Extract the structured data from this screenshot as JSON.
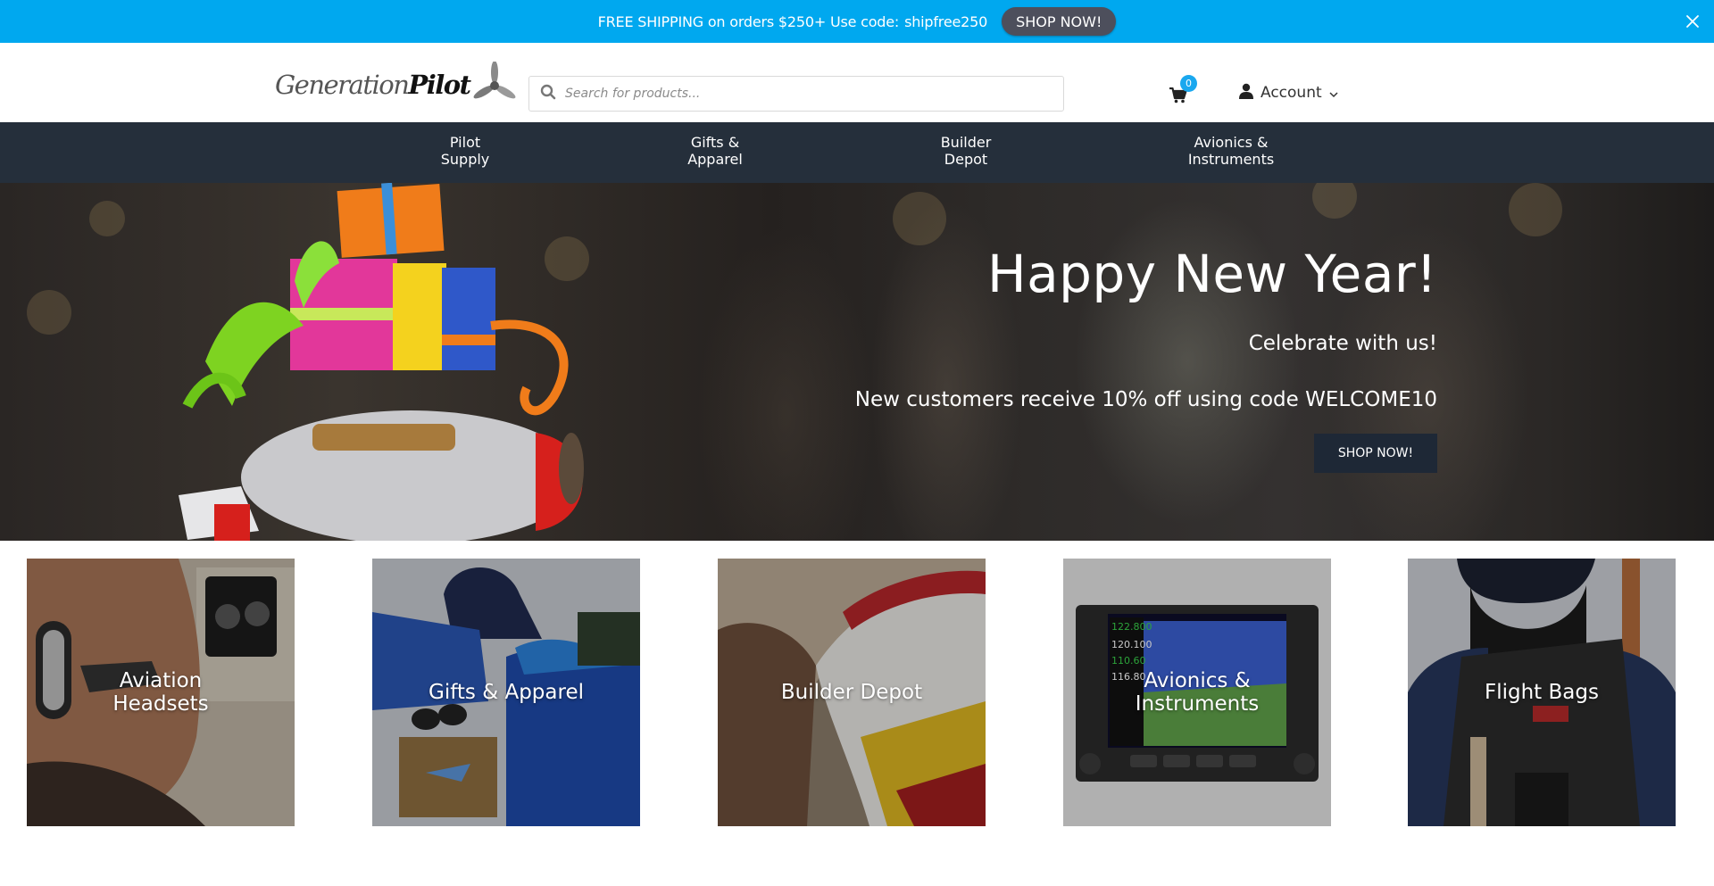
{
  "promo": {
    "text": "FREE SHIPPING on orders $250+ Use code:",
    "code": "shipfree250",
    "button_label": "SHOP NOW!",
    "background_color": "#00a8ef"
  },
  "header": {
    "logo_text_light": "Generation",
    "logo_text_strong": "Pilot",
    "search_placeholder": "Search for products...",
    "cart_count": "0",
    "account_label": "Account"
  },
  "nav": {
    "items": [
      {
        "line1": "Pilot",
        "line2": "Supply"
      },
      {
        "line1": "Gifts &",
        "line2": "Apparel"
      },
      {
        "line1": "Builder",
        "line2": "Depot"
      },
      {
        "line1": "Avionics &",
        "line2": "Instruments"
      }
    ]
  },
  "hero": {
    "title": "Happy New Year!",
    "subtitle": "Celebrate with us!",
    "offer": "New customers receive 10% off using code WELCOME10",
    "button_label": "SHOP NOW!"
  },
  "categories": [
    {
      "line1": "Aviation",
      "line2": "Headsets"
    },
    {
      "line1": "Gifts & Apparel",
      "line2": ""
    },
    {
      "line1": "Builder Depot",
      "line2": ""
    },
    {
      "line1": "Avionics &",
      "line2": "Instruments"
    },
    {
      "line1": "Flight Bags",
      "line2": ""
    }
  ]
}
